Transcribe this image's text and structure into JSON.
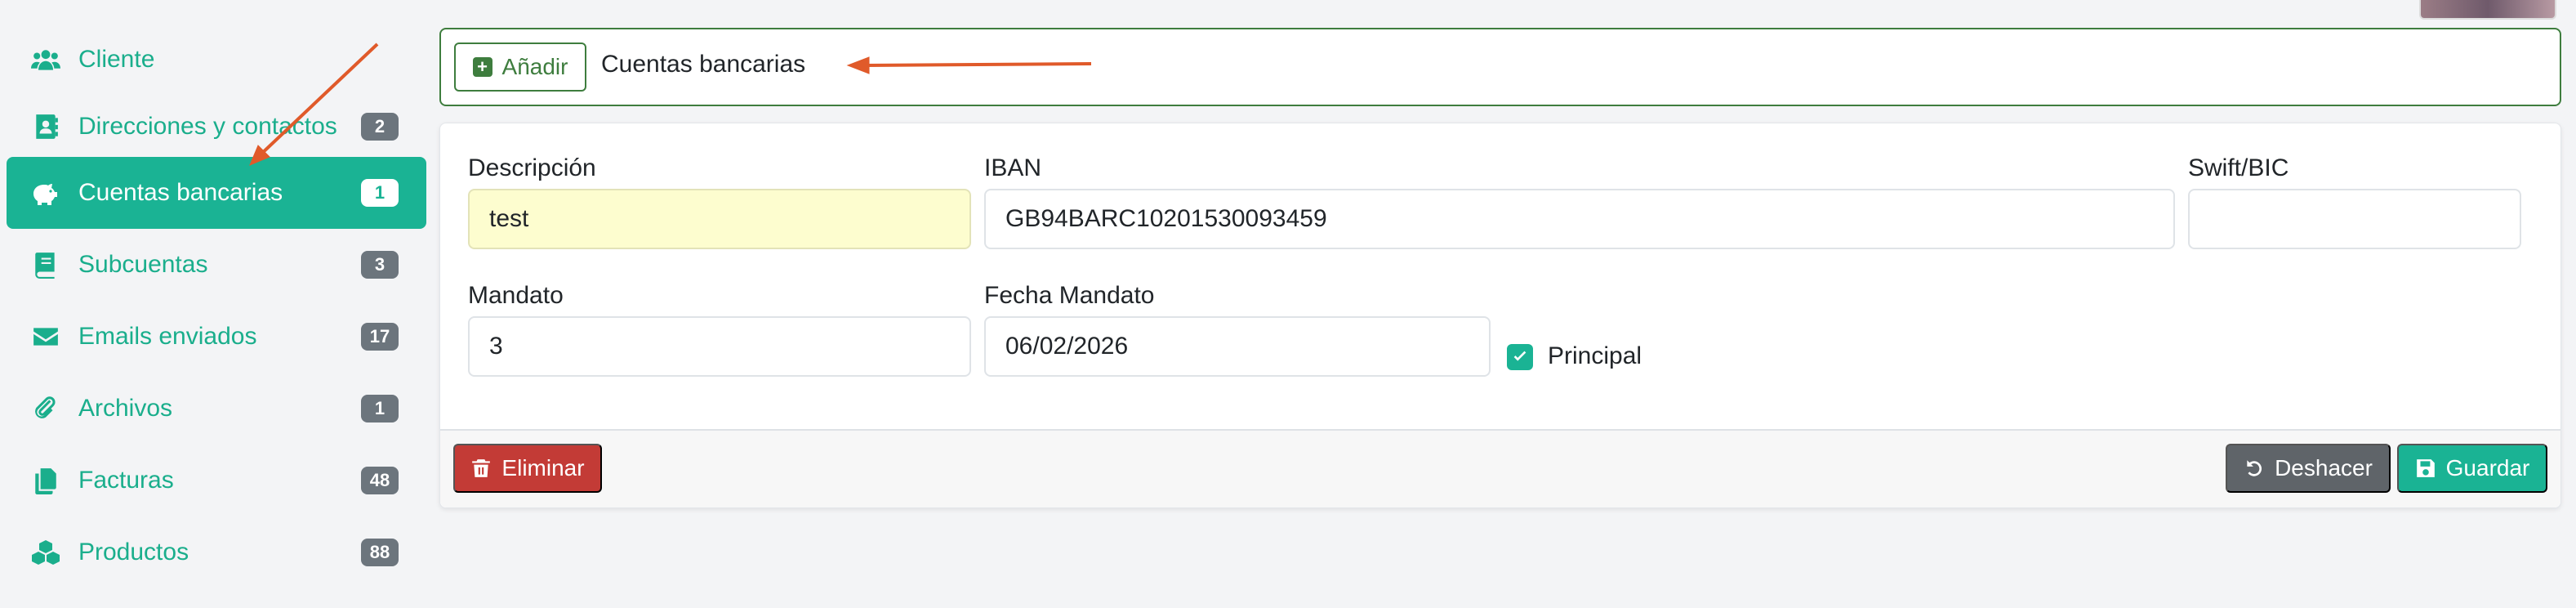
{
  "sidebar": {
    "items": [
      {
        "label": "Cliente",
        "icon": "users-icon",
        "badge": ""
      },
      {
        "label": "Direcciones y contactos",
        "icon": "address-book-icon",
        "badge": "2"
      },
      {
        "label": "Cuentas bancarias",
        "icon": "piggy-bank-icon",
        "badge": "1"
      },
      {
        "label": "Subcuentas",
        "icon": "book-icon",
        "badge": "3"
      },
      {
        "label": "Emails enviados",
        "icon": "envelope-icon",
        "badge": "17"
      },
      {
        "label": "Archivos",
        "icon": "paperclip-icon",
        "badge": "1"
      },
      {
        "label": "Facturas",
        "icon": "copy-icon",
        "badge": "48"
      },
      {
        "label": "Productos",
        "icon": "cubes-icon",
        "badge": "88"
      }
    ],
    "active_index": 2
  },
  "header": {
    "add_label": "Añadir",
    "title": "Cuentas bancarias"
  },
  "form": {
    "descripcion_label": "Descripción",
    "descripcion_value": "test",
    "iban_label": "IBAN",
    "iban_value": "GB94BARC10201530093459",
    "swift_label": "Swift/BIC",
    "swift_value": "",
    "mandato_label": "Mandato",
    "mandato_value": "3",
    "fecha_mandato_label": "Fecha Mandato",
    "fecha_mandato_value": "06/02/2026",
    "principal_label": "Principal",
    "principal_checked": true
  },
  "footer": {
    "delete_label": "Eliminar",
    "undo_label": "Deshacer",
    "save_label": "Guardar"
  },
  "colors": {
    "accent": "#1ab394",
    "danger": "#c33b36",
    "secondary": "#5f6469",
    "arrow": "#e05a2a"
  }
}
